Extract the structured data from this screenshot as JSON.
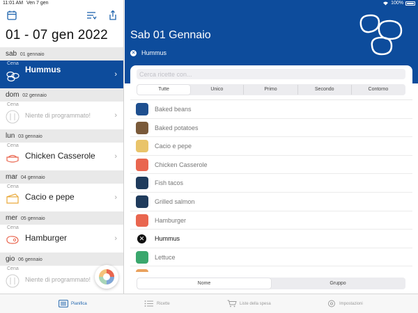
{
  "status_bar": {
    "time": "11:01 AM",
    "date": "Ven 7 gen",
    "battery": "100%"
  },
  "left": {
    "title": "01 - 07 gen 2022",
    "days": [
      {
        "weekday": "sab",
        "date": "01 gennaio",
        "meal": "Cena",
        "dish": "Hummus",
        "empty": false,
        "selected": true
      },
      {
        "weekday": "dom",
        "date": "02 gennaio",
        "meal": "Cena",
        "dish": "Niente di programmato!",
        "empty": true,
        "selected": false
      },
      {
        "weekday": "lun",
        "date": "03 gennaio",
        "meal": "Cena",
        "dish": "Chicken Casserole",
        "empty": false,
        "selected": false
      },
      {
        "weekday": "mar",
        "date": "04 gennaio",
        "meal": "Cena",
        "dish": "Cacio e pepe",
        "empty": false,
        "selected": false
      },
      {
        "weekday": "mer",
        "date": "05 gennaio",
        "meal": "Cena",
        "dish": "Hamburger",
        "empty": false,
        "selected": false
      },
      {
        "weekday": "gio",
        "date": "06 gennaio",
        "meal": "Cena",
        "dish": "Niente di programmato!",
        "empty": true,
        "selected": false
      }
    ]
  },
  "right": {
    "title": "Sab 01 Gennaio",
    "selected_recipe": "Hummus",
    "search_placeholder": "Cerca ricette con...",
    "filters": [
      "Tutte",
      "Unico",
      "Primo",
      "Secondo",
      "Contorno"
    ],
    "active_filter": "Tutte",
    "recipes": [
      {
        "name": "Baked beans",
        "color": "#1e4f8f",
        "icon": "beans-icon"
      },
      {
        "name": "Baked potatoes",
        "color": "#7a5a3a",
        "icon": "potato-icon"
      },
      {
        "name": "Cacio e pepe",
        "color": "#e9c46a",
        "icon": "cheese-icon"
      },
      {
        "name": "Chicken Casserole",
        "color": "#e9664f",
        "icon": "casserole-icon"
      },
      {
        "name": "Fish tacos",
        "color": "#1f3b5c",
        "icon": "fish-icon"
      },
      {
        "name": "Grilled salmon",
        "color": "#1f3b5c",
        "icon": "fish-icon"
      },
      {
        "name": "Hamburger",
        "color": "#e9664f",
        "icon": "meat-icon"
      },
      {
        "name": "Hummus",
        "color": "#111111",
        "icon": "close-icon",
        "selected": true
      },
      {
        "name": "Lettuce",
        "color": "#3aa76d",
        "icon": "lettuce-icon"
      },
      {
        "name": "",
        "color": "#e9a25f",
        "icon": "partial-icon"
      }
    ],
    "sort_options": [
      "Nome",
      "Gruppo"
    ],
    "active_sort": "Nome"
  },
  "tabs": [
    {
      "label": "Pianifica",
      "icon": "calendar-list-icon",
      "active": true
    },
    {
      "label": "Ricette",
      "icon": "list-icon",
      "active": false
    },
    {
      "label": "Liste della spesa",
      "icon": "cart-icon",
      "active": false
    },
    {
      "label": "Impostazioni",
      "icon": "gear-icon",
      "active": false
    }
  ]
}
